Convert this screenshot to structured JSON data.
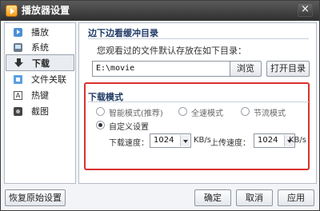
{
  "window": {
    "title": "播放器设置",
    "close_label": "×"
  },
  "sidebar": {
    "items": [
      {
        "label": "播放",
        "icon": "play-icon"
      },
      {
        "label": "系统",
        "icon": "system-icon"
      },
      {
        "label": "下载",
        "icon": "download-icon",
        "active": true
      },
      {
        "label": "文件关联",
        "icon": "file-association-icon"
      },
      {
        "label": "热键",
        "icon": "hotkey-icon",
        "glyph": "A"
      },
      {
        "label": "截图",
        "icon": "camera-icon"
      }
    ]
  },
  "cache_section": {
    "title": "边下边看缓冲目录",
    "hint": "您观看过的文件默认存放在如下目录：",
    "path_value": "E:\\movie",
    "browse_label": "浏览",
    "open_dir_label": "打开目录"
  },
  "download_mode": {
    "title": "下载模式",
    "options": [
      {
        "label": "智能模式(推荐)",
        "selected": false
      },
      {
        "label": "全速模式",
        "selected": false
      },
      {
        "label": "节流模式",
        "selected": false
      },
      {
        "label": "自定义设置",
        "selected": true
      }
    ],
    "download_speed_label": "下载速度：",
    "download_speed_value": "1024",
    "upload_speed_label": "上传速度：",
    "upload_speed_value": "1024",
    "unit": "KB/s"
  },
  "footer": {
    "restore_label": "恢复原始设置",
    "ok_label": "确定",
    "cancel_label": "取消",
    "apply_label": "应用"
  },
  "colors": {
    "highlight_border": "#d9312f",
    "section_title": "#1f3a66"
  }
}
